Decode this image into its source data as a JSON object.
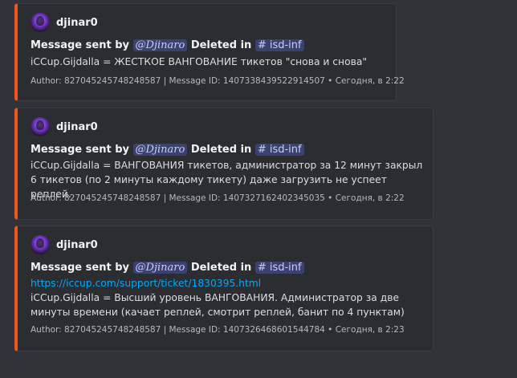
{
  "messages": [
    {
      "author": "djinar0",
      "title_prefix": "Message sent by",
      "mention": "@Djinaro",
      "deleted_in": "Deleted in",
      "channel": "# isd-inf",
      "link": "",
      "description": "iCCup.Gijdalla = ЖЕСТКОЕ ВАНГОВАНИЕ тикетов \"снова и снова\"",
      "footer": "Author: 827045245748248587 | Message ID: 1407338439522914507 • Сегодня, в 2:22"
    },
    {
      "author": "djinar0",
      "title_prefix": "Message sent by",
      "mention": "@Djinaro",
      "deleted_in": "Deleted in",
      "channel": "# isd-inf",
      "link": "",
      "description": "iCCup.Gijdalla = ВАНГОВАНИЯ тикетов, администратор за 12 минут закрыл 6 тикетов (по 2 минуты каждому тикету) даже загрузить не успеет реплей.",
      "footer": "Author: 827045245748248587 | Message ID: 1407327162402345035 • Сегодня, в 2:22"
    },
    {
      "author": "djinar0",
      "title_prefix": "Message sent by",
      "mention": "@Djinaro",
      "deleted_in": "Deleted in",
      "channel": "# isd-inf",
      "link": "https://iccup.com/support/ticket/1830395.html",
      "description": "iCCup.Gijdalla = Высший уровень ВАНГОВАНИЯ. Администратор за две минуты времени (качает реплей, смотрит реплей, банит по 4 пунктам)",
      "footer": "Author: 827045245748248587 | Message ID: 1407326468601544784 • Сегодня, в 2:23"
    }
  ]
}
